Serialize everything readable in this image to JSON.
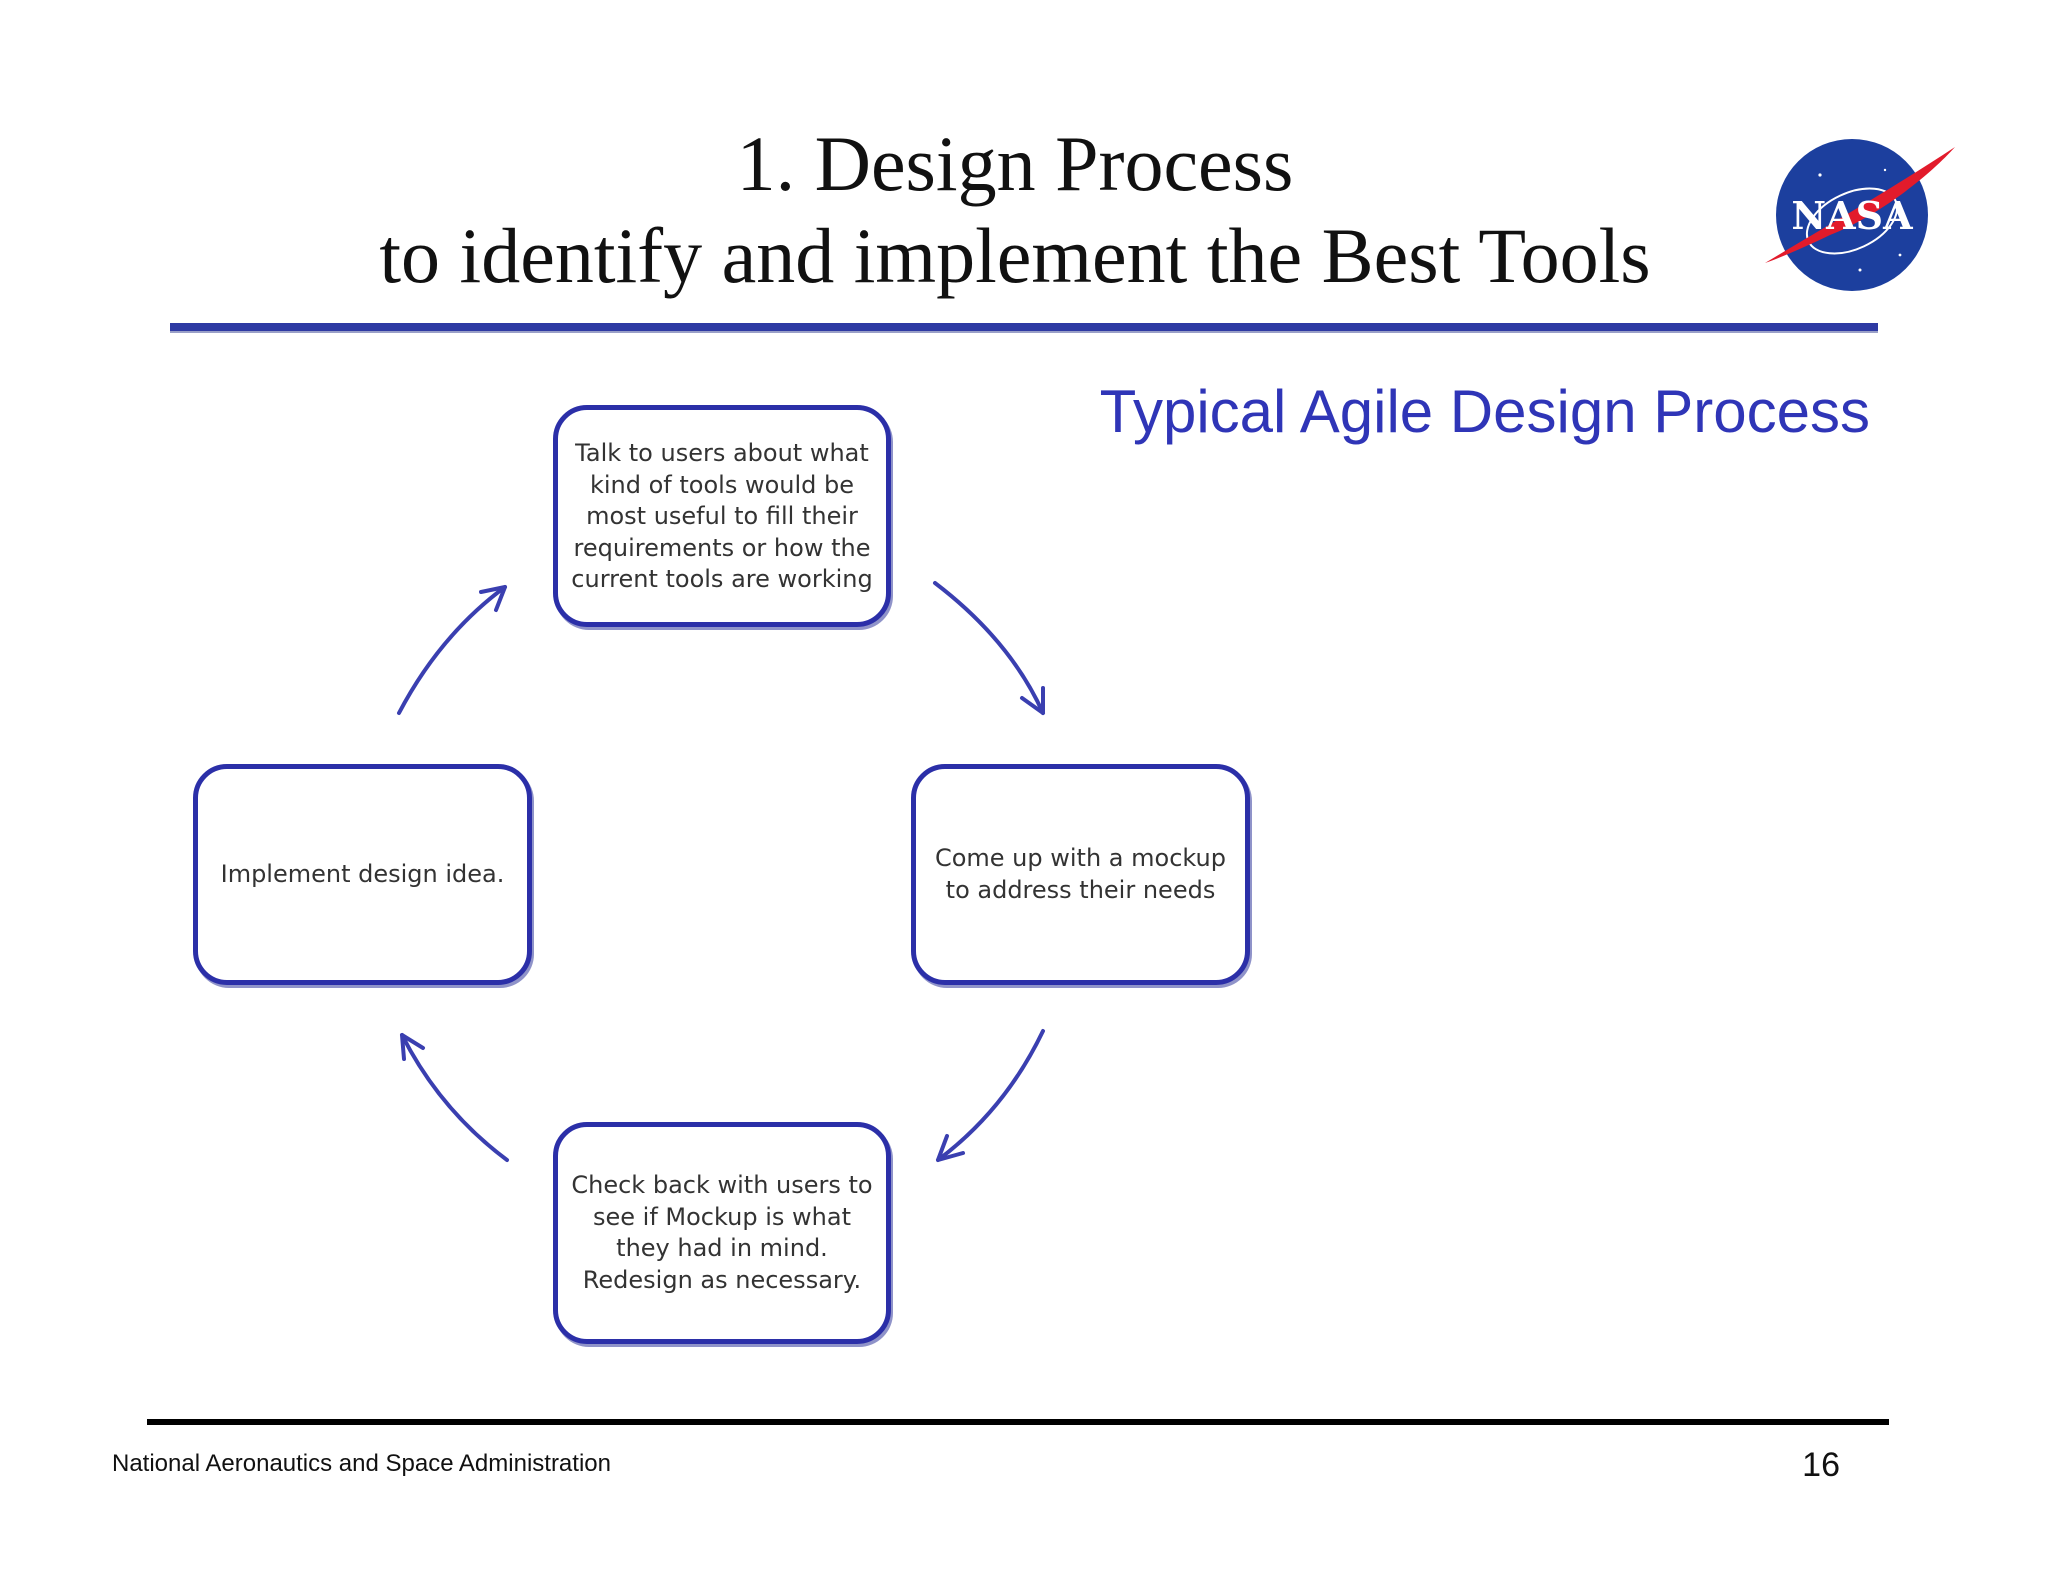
{
  "header": {
    "title_line1": "1. Design Process",
    "title_line2": "to identify and implement the Best Tools",
    "logo_text": "NASA"
  },
  "subtitle": "Typical Agile Design Process",
  "diagram": {
    "steps": [
      "Talk to users about what kind of tools would be most useful to fill their requirements or how the current tools are working",
      "Come up with a mockup to address their needs",
      "Check back with users to see if Mockup is what they had in mind. Redesign as necessary.",
      "Implement design idea."
    ],
    "step_lines": [
      [
        "Talk to users about what",
        "kind of tools would be",
        "most useful to fill their",
        "requirements or how the",
        "current tools are working"
      ],
      [
        "Come up with a mockup",
        "to address their needs"
      ],
      [
        "Check back with users to",
        "see if Mockup is what",
        "they had in mind.",
        "Redesign as necessary."
      ],
      [
        "Implement design idea."
      ]
    ],
    "flow": "clockwise cycle",
    "colors": {
      "box_border": "#2b2fa8",
      "arrow": "#3a3fb0",
      "subtitle": "#2f35b7",
      "header_rule": "#2e3aa3"
    }
  },
  "footer": {
    "organization": "National Aeronautics and Space Administration",
    "page_number": "16"
  }
}
